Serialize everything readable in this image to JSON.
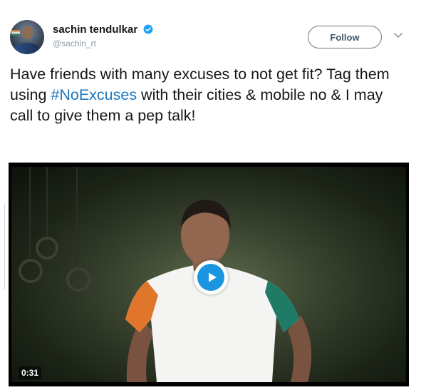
{
  "tweet": {
    "author": {
      "name": "sachin tendulkar",
      "handle": "@sachin_rt",
      "verified": true,
      "verified_color": "#1da1f2"
    },
    "follow_label": "Follow",
    "text_parts": {
      "before": "Have friends with many excuses to not get fit? Tag them using ",
      "hashtag": "#NoExcuses",
      "after": " with their cities & mobile no & I may call to give them a pep talk!"
    },
    "hashtag_color": "#1b78c2"
  },
  "video": {
    "duration": "0:31",
    "play_icon": "play-icon",
    "play_color": "#1b95e0"
  }
}
